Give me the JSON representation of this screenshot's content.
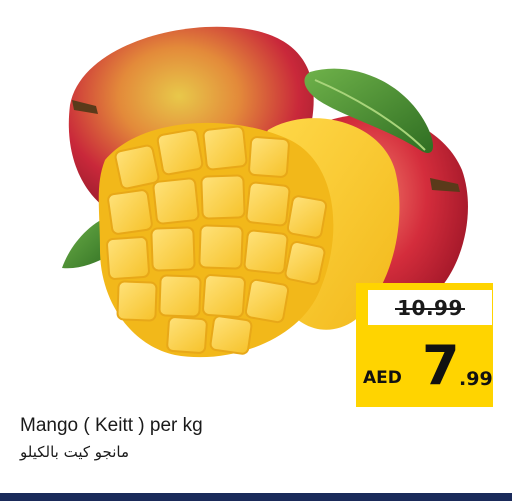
{
  "product": {
    "name_en": "Mango ( Keitt ) per kg",
    "name_ar": "مانجو كيت بالكيلو"
  },
  "price": {
    "old": "10.99",
    "currency": "AED",
    "main": "7",
    "decimal": ".99"
  },
  "image": {
    "icon": "mango-image"
  },
  "colors": {
    "price_box": "#ffd400",
    "bottom_bar": "#1a2a5a"
  }
}
